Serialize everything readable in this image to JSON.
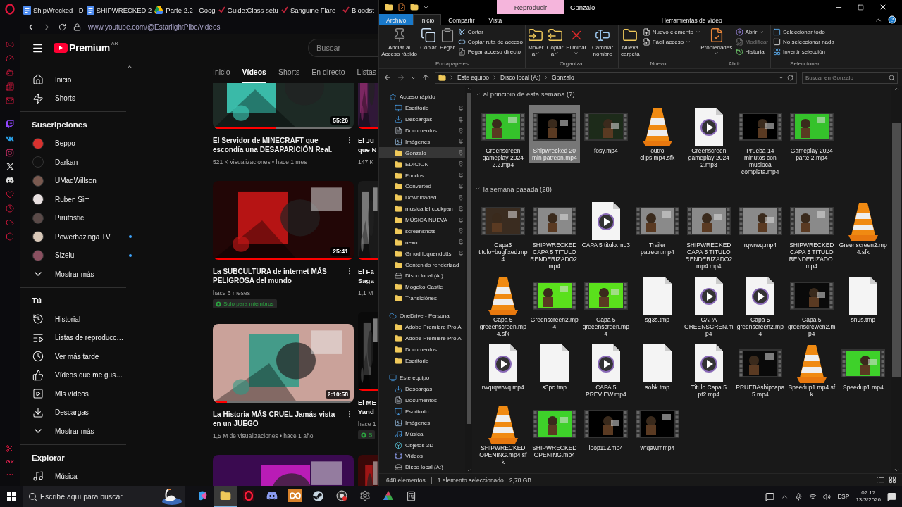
{
  "browser": {
    "tabs": [
      {
        "title": "ShipWrecked - D",
        "kind": "doc"
      },
      {
        "title": "SHIPWRECKED 2",
        "kind": "doc"
      },
      {
        "title": "Parte 2.2 - Goog",
        "kind": "drive"
      },
      {
        "title": "Guide:Class setu",
        "kind": "wiki"
      },
      {
        "title": "Sanguine Flare -",
        "kind": "wiki"
      },
      {
        "title": "Bloodst",
        "kind": "wiki"
      }
    ],
    "address": "www.youtube.com/@EstarlightPibe/videos",
    "sidebar_label": "GX"
  },
  "youtube": {
    "logo": "Premium",
    "region": "AR",
    "search": {
      "placeholder": "Buscar"
    },
    "nav": [
      {
        "label": "Inicio",
        "kind": "home"
      },
      {
        "label": "Shorts",
        "kind": "shorts"
      }
    ],
    "subscriptions": {
      "title": "Suscripciones",
      "more": "Mostrar más",
      "channels": [
        {
          "name": "Beppo",
          "color": "#d8322f",
          "new_content": false
        },
        {
          "name": "Darkan",
          "color": "#111111",
          "new_content": false
        },
        {
          "name": "UMadWillson",
          "color": "#7a5a50",
          "new_content": false
        },
        {
          "name": "Ruben Sim",
          "color": "#e8e0e0",
          "new_content": false
        },
        {
          "name": "Pirutastic",
          "color": "#5a4a48",
          "new_content": false
        },
        {
          "name": "Powerbazinga TV",
          "color": "#d8c8b8",
          "new_content": true
        },
        {
          "name": "Sizelu",
          "color": "#8a5060",
          "new_content": true
        }
      ]
    },
    "you": {
      "title": "Tú",
      "more": "Mostrar más",
      "items": [
        {
          "label": "Historial",
          "kind": "history"
        },
        {
          "label": "Listas de reproducc…",
          "kind": "playlists"
        },
        {
          "label": "Ver más tarde",
          "kind": "later"
        },
        {
          "label": "Vídeos que me gus…",
          "kind": "liked"
        },
        {
          "label": "Mis vídeos",
          "kind": "myvideos"
        },
        {
          "label": "Descargas",
          "kind": "downloads"
        }
      ]
    },
    "explore": {
      "title": "Explorar",
      "items": [
        {
          "label": "Música",
          "kind": "music"
        }
      ]
    },
    "channel_tabs": [
      {
        "label": "Inicio",
        "selected": false
      },
      {
        "label": "Vídeos",
        "selected": true
      },
      {
        "label": "Shorts",
        "selected": false
      },
      {
        "label": "En directo",
        "selected": false
      },
      {
        "label": "Listas",
        "selected": false
      }
    ],
    "videos": [
      {
        "kind": "video",
        "duration": "55:26",
        "title": "El Servidor de MINECRAFT que escondía una DESAPARICIÓN Real.",
        "meta": "521 K visualizaciones • hace 1 mes",
        "level": 0.45
      },
      {
        "kind": "video",
        "duration": "25:41",
        "title": "La SUBCULTURA de internet MÁS PELIGROSA del mundo",
        "meta": "hace 6 meses",
        "badge": "Solo para miembros",
        "level": 1
      },
      {
        "kind": "video",
        "duration": "2:10:58",
        "title": "La Historia MÁS CRUEL Jamás vista en un JUEGO",
        "meta": "1,5 M de visualizaciones • hace 1 año",
        "level": 0.1
      },
      {
        "kind": "thumbnail_only"
      }
    ],
    "videos_column_2": [
      {
        "kind": "video",
        "title_lines": [
          "El Ju",
          "que N"
        ],
        "meta": "147 K",
        "level": 1
      },
      {
        "kind": "video",
        "title_lines": [
          "El Fa",
          "Saga"
        ],
        "meta": "1,1 M",
        "level": 1
      },
      {
        "kind": "video",
        "title_lines": [
          "El ME",
          "Yand"
        ],
        "meta": "hace 1",
        "badge": "S",
        "level": 1
      },
      {
        "kind": "thumbnail_only"
      }
    ]
  },
  "explorer": {
    "title": "Gonzalo",
    "context_tab": "Reproducir",
    "ribbon_tabs": [
      {
        "label": "Archivo",
        "kind": "file",
        "selected": false
      },
      {
        "label": "Inicio",
        "kind": "tab",
        "selected": true
      },
      {
        "label": "Compartir",
        "kind": "tab",
        "selected": false
      },
      {
        "label": "Vista",
        "kind": "tab",
        "selected": false
      },
      {
        "label": "Herramientas de vídeo",
        "kind": "context",
        "selected": false
      }
    ],
    "ribbon_groups": [
      {
        "title": "Portapapeles",
        "large": [
          {
            "label": "Anclar al Acceso rápido",
            "kind": "pin",
            "disabled": false,
            "dropdown": false
          },
          {
            "label": "Copiar",
            "kind": "copy",
            "disabled": false,
            "dropdown": false
          },
          {
            "label": "Pegar",
            "kind": "paste",
            "disabled": false,
            "dropdown": false
          }
        ],
        "small": [
          {
            "label": "Cortar",
            "kind": "cut",
            "disabled": false,
            "dropdown": false
          },
          {
            "label": "Copiar ruta de acceso",
            "kind": "copy-path",
            "disabled": false,
            "dropdown": false
          },
          {
            "label": "Pegar acceso directo",
            "kind": "paste-shortcut",
            "disabled": false,
            "dropdown": false
          }
        ]
      },
      {
        "title": "Organizar",
        "large": [
          {
            "label": "Mover a",
            "kind": "move",
            "disabled": false,
            "dropdown": true
          },
          {
            "label": "Copiar a",
            "kind": "copy-to",
            "disabled": false,
            "dropdown": true
          },
          {
            "label": "Eliminar",
            "kind": "delete",
            "disabled": false,
            "dropdown": true
          },
          {
            "label": "Cambiar nombre",
            "kind": "rename",
            "disabled": false,
            "dropdown": false
          }
        ]
      },
      {
        "title": "Nuevo",
        "large": [
          {
            "label": "Nueva carpeta",
            "kind": "new-folder",
            "disabled": false,
            "dropdown": false
          }
        ],
        "small": [
          {
            "label": "Nuevo elemento",
            "kind": "new-item",
            "disabled": false,
            "dropdown": true
          },
          {
            "label": "Fácil acceso",
            "kind": "easy-access",
            "disabled": false,
            "dropdown": true
          }
        ]
      },
      {
        "title": "Abrir",
        "large": [
          {
            "label": "Propiedades",
            "kind": "properties",
            "disabled": false,
            "dropdown": true
          }
        ],
        "small": [
          {
            "label": "Abrir",
            "kind": "open",
            "disabled": false,
            "dropdown": true
          },
          {
            "label": "Modificar",
            "kind": "edit",
            "disabled": true,
            "dropdown": false
          },
          {
            "label": "Historial",
            "kind": "history",
            "disabled": false,
            "dropdown": false
          }
        ]
      },
      {
        "title": "Seleccionar",
        "small": [
          {
            "label": "Seleccionar todo",
            "kind": "select-all",
            "disabled": false,
            "dropdown": false
          },
          {
            "label": "No seleccionar nada",
            "kind": "select-none",
            "disabled": false,
            "dropdown": false
          },
          {
            "label": "Invertir selección",
            "kind": "invert",
            "disabled": false,
            "dropdown": false
          }
        ]
      }
    ],
    "path": [
      "Este equipo",
      "Disco local (A:)",
      "Gonzalo"
    ],
    "search": {
      "placeholder": "Buscar en Gonzalo"
    },
    "nav_tree": [
      {
        "label": "Acceso rápido",
        "kind": "star",
        "selected": false,
        "children": [
          {
            "label": "Escritorio",
            "kind": "desktop",
            "pinned": true,
            "selected": false
          },
          {
            "label": "Descargas",
            "kind": "download",
            "pinned": true,
            "selected": false
          },
          {
            "label": "Documentos",
            "kind": "docs",
            "pinned": true,
            "selected": false
          },
          {
            "label": "Imágenes",
            "kind": "images",
            "pinned": true,
            "selected": false
          },
          {
            "label": "Gonzalo",
            "kind": "folder",
            "pinned": true,
            "selected": true
          },
          {
            "label": "EDICION",
            "kind": "folder",
            "pinned": true,
            "selected": false
          },
          {
            "label": "Fondos",
            "kind": "folder",
            "pinned": true,
            "selected": false
          },
          {
            "label": "Converted",
            "kind": "folder",
            "pinned": true,
            "selected": false
          },
          {
            "label": "Downloaded",
            "kind": "folder",
            "pinned": true,
            "selected": false
          },
          {
            "label": "musica lel cockpan",
            "kind": "folder",
            "pinned": true,
            "selected": false
          },
          {
            "label": "MÚSICA NUEVA",
            "kind": "folder",
            "pinned": true,
            "selected": false
          },
          {
            "label": "screenshots",
            "kind": "folder",
            "pinned": true,
            "selected": false
          },
          {
            "label": "nexo",
            "kind": "folder",
            "pinned": true,
            "selected": false
          },
          {
            "label": "Gmod loquendotts",
            "kind": "folder",
            "pinned": true,
            "selected": false
          },
          {
            "label": "Contenido renderizad",
            "kind": "folder",
            "pinned": false,
            "selected": false
          },
          {
            "label": "Disco local (A:)",
            "kind": "drive",
            "pinned": false,
            "selected": false
          },
          {
            "label": "Mogeko Castle",
            "kind": "folder",
            "pinned": false,
            "selected": false
          },
          {
            "label": "Transiciónes",
            "kind": "folder",
            "pinned": false,
            "selected": false
          }
        ]
      },
      {
        "label": "OneDrive - Personal",
        "kind": "cloud",
        "selected": false,
        "children": [
          {
            "label": "Adobe Premiere Pro A",
            "kind": "folder",
            "pinned": false,
            "selected": false
          },
          {
            "label": "Adobe Premiere Pro A",
            "kind": "folder",
            "pinned": false,
            "selected": false
          },
          {
            "label": "Documentos",
            "kind": "folder",
            "pinned": false,
            "selected": false
          },
          {
            "label": "Escritorio",
            "kind": "folder",
            "pinned": false,
            "selected": false
          }
        ]
      },
      {
        "label": "Este equipo",
        "kind": "pc",
        "selected": false,
        "children": [
          {
            "label": "Descargas",
            "kind": "download",
            "pinned": false,
            "selected": false
          },
          {
            "label": "Documentos",
            "kind": "docs",
            "pinned": false,
            "selected": false
          },
          {
            "label": "Escritorio",
            "kind": "desktop",
            "pinned": false,
            "selected": false
          },
          {
            "label": "Imágenes",
            "kind": "images",
            "pinned": false,
            "selected": false
          },
          {
            "label": "Música",
            "kind": "music",
            "pinned": false,
            "selected": false
          },
          {
            "label": "Objetos 3D",
            "kind": "cube",
            "pinned": false,
            "selected": false
          },
          {
            "label": "Vídeos",
            "kind": "videos",
            "pinned": false,
            "selected": false
          },
          {
            "label": "Disco local (A:)",
            "kind": "drive",
            "pinned": false,
            "selected": false
          }
        ]
      }
    ],
    "file_groups": [
      {
        "title": "al principio de esta semana (7)",
        "expanded": true,
        "files": [
          {
            "name": "Greenscreen gameplay 2024 2.2.mp4",
            "kind": "video",
            "color": "#35c22b",
            "selected": false
          },
          {
            "name": "Shipwrecked 20 min patreon.mp4",
            "kind": "video",
            "color": "#000000",
            "selected": true
          },
          {
            "name": "fosy.mp4",
            "kind": "video",
            "color": "#1d2b1a",
            "selected": false
          },
          {
            "name": "outro clips.mp4.sfk",
            "kind": "vlc",
            "selected": false
          },
          {
            "name": "Greenscreen gameplay 2024 2.mp3",
            "kind": "media",
            "selected": false
          },
          {
            "name": "Prueba 14 minutos con musioca completa.mp4",
            "kind": "video",
            "color": "#000000",
            "selected": false
          },
          {
            "name": "Gameplay 2024 parte 2.mp4",
            "kind": "video",
            "color": "#35c22b",
            "selected": false
          }
        ]
      },
      {
        "title": "la semana pasada (28)",
        "expanded": true,
        "files": [
          {
            "name": "Capa3 titulo+bugfixed.mp4",
            "kind": "video",
            "color": "#3a2c20",
            "selected": false
          },
          {
            "name": "SHIPWRECKED CAPA 5 TITULO RENDERIZADO2.mp4",
            "kind": "video",
            "color": "#8a8a8a",
            "selected": false
          },
          {
            "name": "CAPA 5 titulo.mp3",
            "kind": "media",
            "selected": false
          },
          {
            "name": "Trailer patreon.mp4",
            "kind": "video",
            "color": "#8a8a8a",
            "selected": false
          },
          {
            "name": "SHIPWRECKED CAPA 5 TITULO RENDERIZADO2 mp4.mp4",
            "kind": "video",
            "color": "#8a8a8a",
            "selected": false
          },
          {
            "name": "rqwrwq.mp4",
            "kind": "video",
            "color": "#8a8a8a",
            "selected": false
          },
          {
            "name": "SHIPWRECKED CAPA 5 TITULO RENDERIZADO.mp4",
            "kind": "video",
            "color": "#8a8a8a",
            "selected": false
          },
          {
            "name": "Greenscreen2.mp4.sfk",
            "kind": "vlc",
            "selected": false
          },
          {
            "name": "Capa 5 greeenscreen.mp4.sfk",
            "kind": "vlc",
            "selected": false
          },
          {
            "name": "Greenscreen2.mp4",
            "kind": "video",
            "color": "#5ae01c",
            "selected": false
          },
          {
            "name": "Capa 5 greeenscreen.mp4",
            "kind": "video",
            "color": "#5ae01c",
            "selected": false
          },
          {
            "name": "sg3s.tmp",
            "kind": "blank",
            "selected": false
          },
          {
            "name": "CAPA GREENSCREN.mp4",
            "kind": "media",
            "selected": false
          },
          {
            "name": "Capa 5 greenscreen2.mp4",
            "kind": "media",
            "selected": false
          },
          {
            "name": "Capa 5 greenscrewen2.mp4",
            "kind": "video",
            "color": "#0a0a0a",
            "selected": false
          },
          {
            "name": "sn9s.tmp",
            "kind": "blank",
            "selected": false
          },
          {
            "name": "rwqrqwrwq.mp4",
            "kind": "media",
            "selected": false
          },
          {
            "name": "s3pc.tmp",
            "kind": "blank",
            "selected": false
          },
          {
            "name": "CAPA 5 PREVIEW.mp4",
            "kind": "media",
            "selected": false
          },
          {
            "name": "sohk.tmp",
            "kind": "blank",
            "selected": false
          },
          {
            "name": "Titulo Capa 5 pt2.mp4",
            "kind": "media",
            "selected": false
          },
          {
            "name": "PRUEBAshipcapa5.mp4",
            "kind": "video",
            "color": "#0a0a0a",
            "selected": false
          },
          {
            "name": "Speedup1.mp4.sfk",
            "kind": "vlc",
            "selected": false
          },
          {
            "name": "Speedup1.mp4",
            "kind": "video",
            "color": "#3ed12a",
            "selected": false
          },
          {
            "name": "SHIPWRECKED OPENING.mp4.sfk",
            "kind": "vlc",
            "selected": false
          },
          {
            "name": "SHIPWRECKED OPENING.mp4",
            "kind": "video",
            "color": "#3ed12a",
            "selected": false
          },
          {
            "name": "loop112.mp4",
            "kind": "video",
            "color": "#000000",
            "selected": false
          },
          {
            "name": "wrqawrr.mp4",
            "kind": "video",
            "color": "#000000",
            "selected": false
          }
        ]
      }
    ],
    "status": {
      "count": "648 elementos",
      "selection": "1 elemento seleccionado",
      "size": "2,78 GB"
    }
  },
  "taskbar": {
    "search": {
      "placeholder": "Escribe aquí para buscar"
    },
    "apps": [
      {
        "kind": "copilot",
        "active": false
      },
      {
        "kind": "files",
        "active": true
      },
      {
        "kind": "opera",
        "active": false
      },
      {
        "kind": "discord",
        "active": false
      },
      {
        "kind": "meta",
        "active": false
      },
      {
        "kind": "steam",
        "active": false
      },
      {
        "kind": "obs",
        "active": false
      },
      {
        "kind": "settings",
        "active": false
      },
      {
        "kind": "affinity",
        "active": false
      },
      {
        "kind": "calculator",
        "active": false
      }
    ],
    "language": "ESP",
    "time": "02:17",
    "date": "13/3/2026"
  }
}
